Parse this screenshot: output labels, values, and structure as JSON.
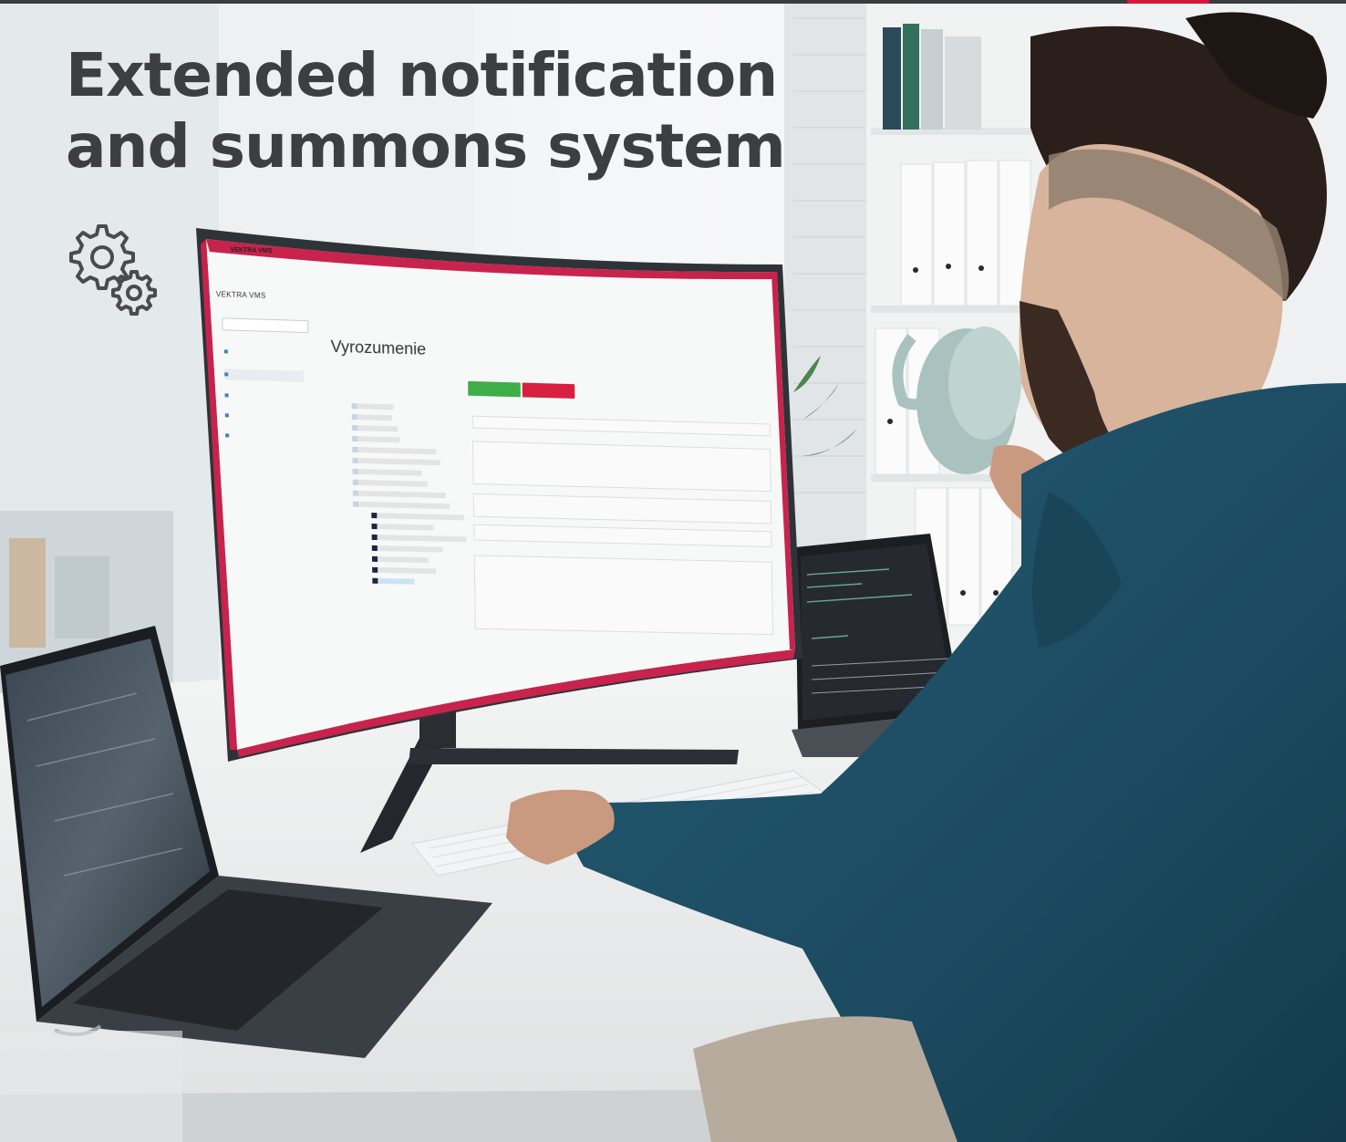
{
  "headline": {
    "line1": "Extended notification",
    "line2": "and summons system"
  },
  "icons": {
    "gears": "gears-icon"
  },
  "colors": {
    "headline": "#3d3e40",
    "accent_red": "#d6183c",
    "button_green": "#3fae49",
    "button_red": "#d6203f"
  },
  "screen": {
    "tab_title": "VEKTRA VMS",
    "app_title": "VEKTRA VMS",
    "page_heading": "Vyrozumenie"
  }
}
